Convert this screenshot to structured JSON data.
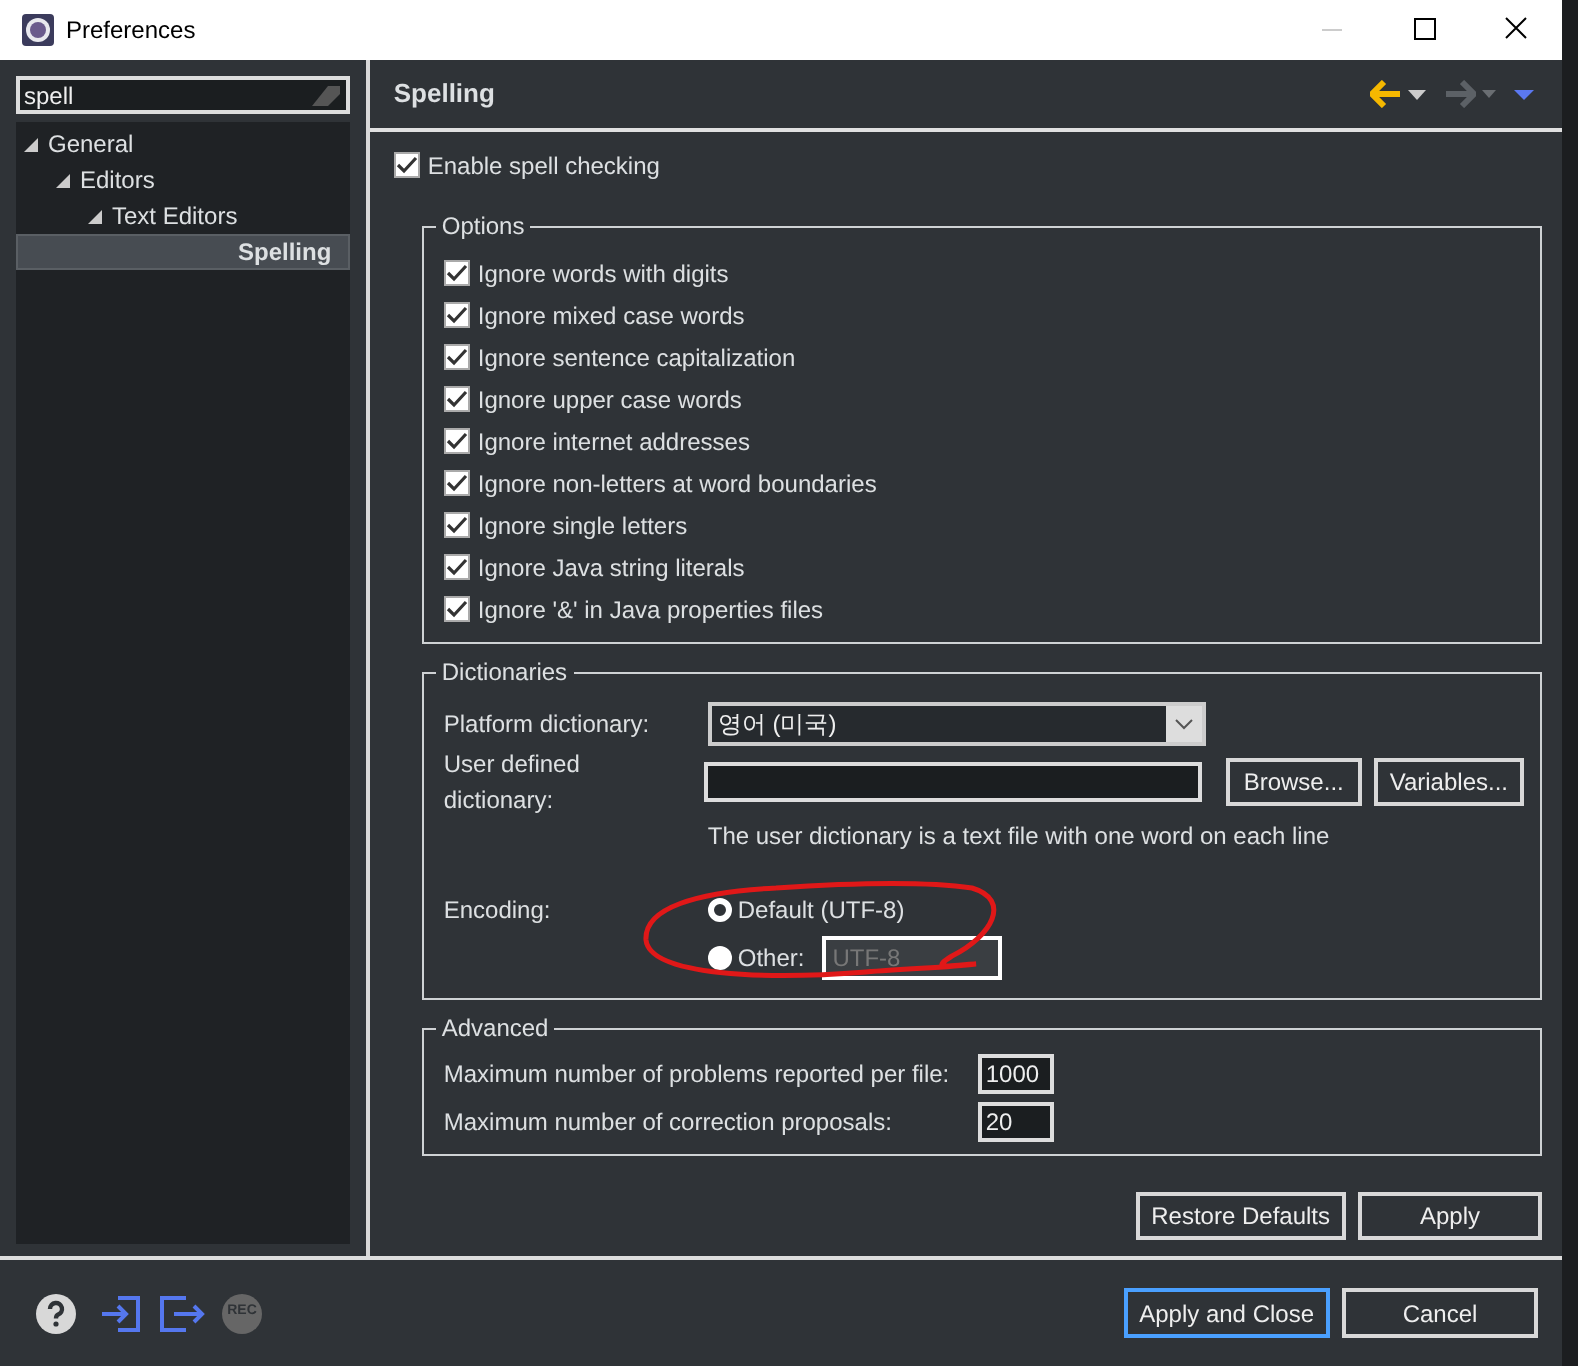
{
  "window": {
    "title": "Preferences"
  },
  "filter": {
    "value": "spell"
  },
  "tree": [
    {
      "label": "General",
      "expanded": true,
      "selected": false,
      "children": [
        {
          "label": "Editors",
          "expanded": true,
          "selected": false,
          "children": [
            {
              "label": "Text Editors",
              "expanded": true,
              "selected": false,
              "children": [
                {
                  "label": "Spelling",
                  "selected": true
                }
              ]
            }
          ]
        }
      ]
    }
  ],
  "page": {
    "title": "Spelling",
    "enable": {
      "label": "Enable spell checking",
      "checked": true
    },
    "options": {
      "title": "Options",
      "items": [
        {
          "label": "Ignore words with digits",
          "checked": true
        },
        {
          "label": "Ignore mixed case words",
          "checked": true
        },
        {
          "label": "Ignore sentence capitalization",
          "checked": true
        },
        {
          "label": "Ignore upper case words",
          "checked": true
        },
        {
          "label": "Ignore internet addresses",
          "checked": true
        },
        {
          "label": "Ignore non-letters at word boundaries",
          "checked": true
        },
        {
          "label": "Ignore single letters",
          "checked": true
        },
        {
          "label": "Ignore Java string literals",
          "checked": true
        },
        {
          "label": "Ignore '&' in Java properties files",
          "checked": true
        }
      ]
    },
    "dictionaries": {
      "title": "Dictionaries",
      "platform_label": "Platform dictionary:",
      "platform_value": "영어 (미국)",
      "user_label": "User defined dictionary:",
      "browse": "Browse...",
      "variables": "Variables...",
      "hint": "The user dictionary is a text file with one word on each line",
      "encoding_label": "Encoding:",
      "encodings": [
        {
          "label": "Default (UTF-8)",
          "selected": true
        },
        {
          "label": "Other:",
          "selected": false
        }
      ],
      "other_value": "UTF-8",
      "other_disabled": true
    },
    "advanced": {
      "title": "Advanced",
      "fields": [
        {
          "label": "Maximum number of problems reported per file:",
          "value": "1000"
        },
        {
          "label": "Maximum number of correction proposals:",
          "value": "20"
        }
      ]
    },
    "buttons": [
      "Restore Defaults",
      "Apply"
    ]
  },
  "footer": {
    "rec_label": "REC",
    "buttons": [
      {
        "label": "Apply and Close",
        "default": true
      },
      {
        "label": "Cancel",
        "default": false
      }
    ]
  }
}
